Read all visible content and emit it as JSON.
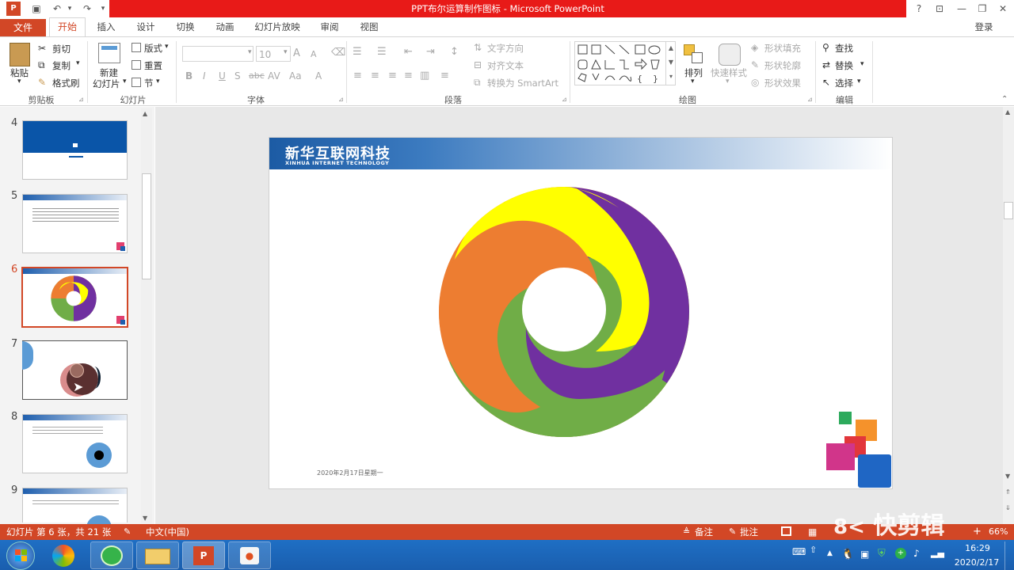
{
  "window": {
    "title": "PPT布尔运算制作图标 - Microsoft PowerPoint",
    "help": "?",
    "user": "登录"
  },
  "tabs": [
    "文件",
    "开始",
    "插入",
    "设计",
    "切换",
    "动画",
    "幻灯片放映",
    "审阅",
    "视图"
  ],
  "ribbon": {
    "clipboard": {
      "paste": "粘贴",
      "cut": "剪切",
      "copy": "复制",
      "format_painter": "格式刷",
      "label": "剪贴板"
    },
    "slides": {
      "new_slide_1": "新建",
      "new_slide_2": "幻灯片",
      "layout": "版式",
      "reset": "重置",
      "section": "节",
      "label": "幻灯片"
    },
    "font": {
      "size": "10",
      "label": "字体",
      "bold": "B",
      "italic": "I",
      "underline": "U",
      "strike": "S",
      "spacing": "abc",
      "case": "Aa",
      "grow": "A",
      "shrink": "A"
    },
    "paragraph": {
      "text_direction": "文字方向",
      "align_text": "对齐文本",
      "smartart": "转换为 SmartArt",
      "label": "段落"
    },
    "drawing": {
      "arrange": "排列",
      "quick_styles": "快速样式",
      "fill": "形状填充",
      "outline": "形状轮廓",
      "effects": "形状效果",
      "label": "绘图"
    },
    "editing": {
      "find": "查找",
      "replace": "替换",
      "select": "选择",
      "label": "编辑"
    }
  },
  "slides_panel": [
    {
      "num": "4"
    },
    {
      "num": "5"
    },
    {
      "num": "6"
    },
    {
      "num": "7"
    },
    {
      "num": "8"
    },
    {
      "num": "9"
    }
  ],
  "slide": {
    "header_title": "新华互联网科技",
    "header_subtitle": "XINHUA INTERNET TECHNOLOGY",
    "date": "2020年2月17日星期一"
  },
  "statusbar": {
    "slide_info": "幻灯片 第 6 张，共 21 张",
    "language": "中文(中国)",
    "notes": "备注",
    "comments": "批注",
    "zoom": "66%",
    "watermark": "快剪辑"
  },
  "taskbar": {
    "time": "16:29",
    "date": "2020/2/17"
  },
  "colors": {
    "accent": "#d24726",
    "title_red": "#e81a18",
    "yellow": "#ffff00",
    "purple": "#7030a0",
    "green": "#70ad47",
    "orange": "#ed7d31"
  }
}
